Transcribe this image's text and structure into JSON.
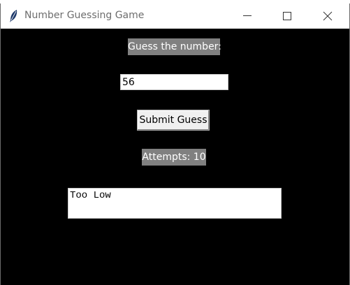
{
  "window": {
    "title": "Number Guessing Game",
    "icon": "feather-icon"
  },
  "controls": {
    "minimize_icon": "minimize-icon",
    "maximize_icon": "maximize-icon",
    "close_icon": "close-icon"
  },
  "form": {
    "prompt_label": "Guess the number:",
    "guess_value": "56",
    "submit_label": "Submit Guess",
    "attempts_label": "Attempts: 10",
    "result_text": "Too Low"
  },
  "colors": {
    "background": "#000000",
    "label_background": "#808080",
    "label_text": "#ffffff"
  }
}
